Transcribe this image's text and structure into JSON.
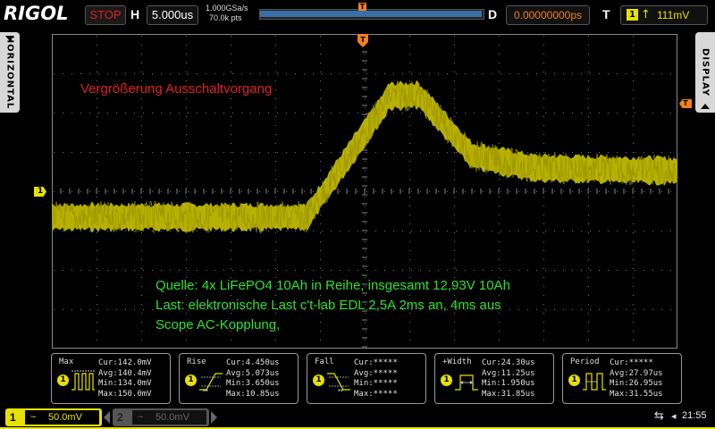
{
  "topbar": {
    "brand": "RIGOL",
    "run_state": "STOP",
    "h_label": "H",
    "timebase": "5.000us",
    "sample_rate": "1.000GSa/s",
    "memory_depth": "70.0k pts",
    "trigger_marker": "T",
    "d_label": "D",
    "delay": "0.00000000ps",
    "t_label": "T",
    "trigger_channel": "1",
    "trigger_edge": "rising",
    "trigger_level": "111mV"
  },
  "side_tabs": {
    "left": "HORIZONTAL",
    "right": "DISPLAY"
  },
  "markers": {
    "ch1": "1",
    "trigger_position": "T",
    "trigger_level": "T"
  },
  "annotations": {
    "title": "Vergrößerung Ausschaltvorgang",
    "line1": "Quelle: 4x LiFePO4 10Ah in Reihe, insgesamt 12,93V 10Ah",
    "line2": "Last: elektronische Last c't-lab EDL  2,5A 2ms an, 4ms aus",
    "line3": "Scope AC-Kopplung,"
  },
  "measurements": [
    {
      "title": "Max",
      "channel": "1",
      "icon": "max-icon",
      "cur": "Cur:142.0mV",
      "avg": "Avg:140.4mV",
      "min": "Min:134.0mV",
      "max": "Max:150.0mV"
    },
    {
      "title": "Rise",
      "channel": "1",
      "icon": "rise-icon",
      "cur": "Cur:4.450us",
      "avg": "Avg:5.073us",
      "min": "Min:3.650us",
      "max": "Max:10.85us"
    },
    {
      "title": "Fall",
      "channel": "1",
      "icon": "fall-icon",
      "cur": "Cur:*****",
      "avg": "Avg:*****",
      "min": "Min:*****",
      "max": "Max:*****"
    },
    {
      "title": "+Width",
      "channel": "1",
      "icon": "pos-width-icon",
      "cur": "Cur:24.30us",
      "avg": "Avg:11.25us",
      "min": "Min:1.950us",
      "max": "Max:31.85us"
    },
    {
      "title": "Period",
      "channel": "1",
      "icon": "period-icon",
      "cur": "Cur:*****",
      "avg": "Avg:27.97us",
      "min": "Min:26.95us",
      "max": "Max:31.55us"
    }
  ],
  "channels": {
    "ch1": {
      "number": "1",
      "coupling": "~",
      "scale": "50.0mV"
    },
    "ch2": {
      "number": "2",
      "coupling": "~",
      "scale": "50.0mV"
    }
  },
  "status": {
    "clock": "21:55"
  },
  "colors": {
    "ch1": "#e8e000",
    "trace": "#b8b000",
    "trigger": "#f08020",
    "annotation_title": "#e02020",
    "annotation_text": "#30e030"
  }
}
